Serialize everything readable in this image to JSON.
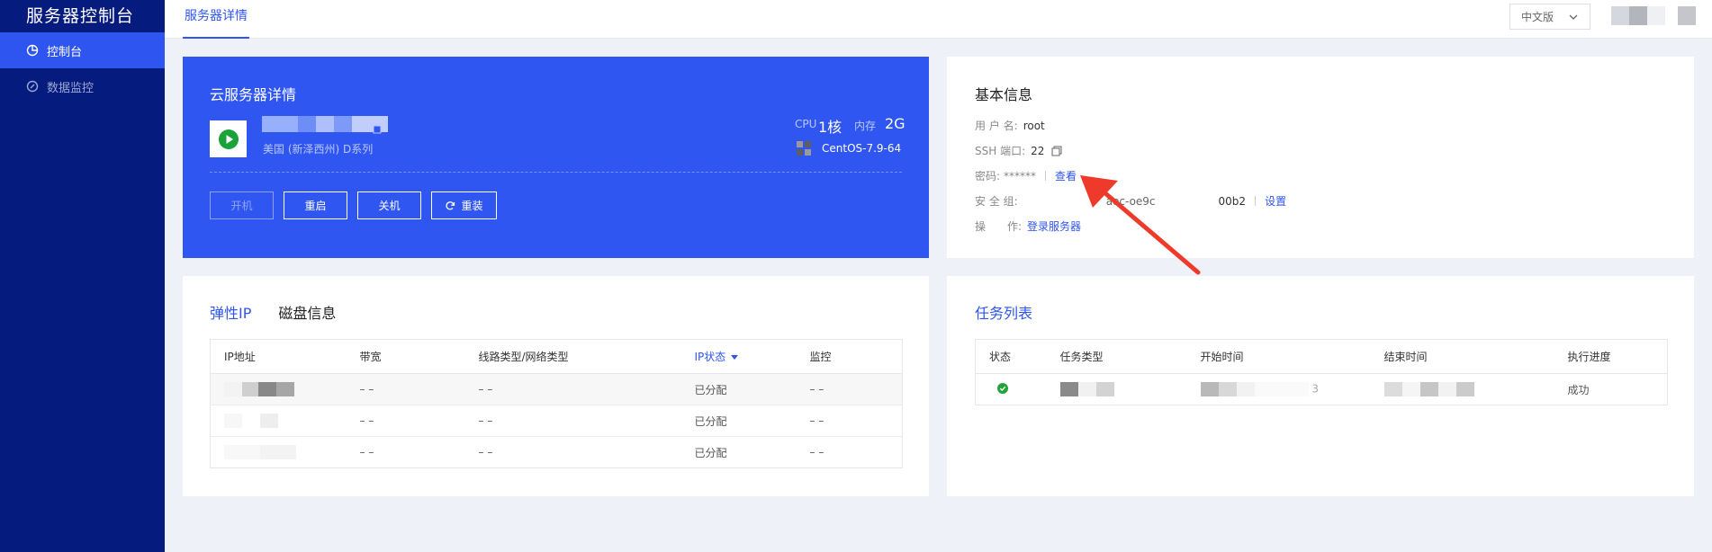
{
  "app": {
    "title": "服务器控制台"
  },
  "sidebar": {
    "items": [
      {
        "label": "控制台",
        "icon": "dashboard-icon",
        "active": true
      },
      {
        "label": "数据监控",
        "icon": "monitor-icon",
        "active": false
      }
    ]
  },
  "header": {
    "tab": "服务器详情",
    "language": "中文版"
  },
  "server": {
    "title": "云服务器详情",
    "region": "美国 (新泽西州) D系列",
    "cpu_label": "CPU",
    "cpu_value": "1核",
    "mem_label": "内存",
    "mem_value": "2G",
    "os": "CentOS-7.9-64",
    "buttons": {
      "start": "开机",
      "restart": "重启",
      "shutdown": "关机",
      "reinstall": "重装"
    }
  },
  "basic_info": {
    "title": "基本信息",
    "username_label": "用 户 名:",
    "username": "root",
    "ssh_label": "SSH 端口:",
    "ssh_port": "22",
    "password_label": "密码:",
    "password": "******",
    "view_link": "查看",
    "security_label": "安 全 组:",
    "security_fragment_1": "aec-oe9c",
    "security_fragment_2": "00b2",
    "settings_link": "设置",
    "operation_label": "操　　作:",
    "login_link": "登录服务器"
  },
  "eip": {
    "tab_active": "弹性IP",
    "tab_other": "磁盘信息",
    "columns": [
      "IP地址",
      "带宽",
      "线路类型/网络类型",
      "IP状态",
      "监控"
    ],
    "rows": [
      {
        "bandwidth": "– –",
        "line": "– –",
        "status": "已分配",
        "monitor": "– –"
      },
      {
        "bandwidth": "– –",
        "line": "– –",
        "status": "已分配",
        "monitor": "– –"
      },
      {
        "bandwidth": "– –",
        "line": "– –",
        "status": "已分配",
        "monitor": "– –"
      }
    ]
  },
  "tasks": {
    "title": "任务列表",
    "columns": [
      "状态",
      "任务类型",
      "开始时间",
      "结束时间",
      "执行进度"
    ],
    "rows": [
      {
        "start_tail": "3",
        "progress": "成功"
      }
    ]
  },
  "colors": {
    "sidebar_bg": "#061b7e",
    "accent": "#2f55f0",
    "success": "#23a33a",
    "arrow": "#ee3a2a"
  }
}
